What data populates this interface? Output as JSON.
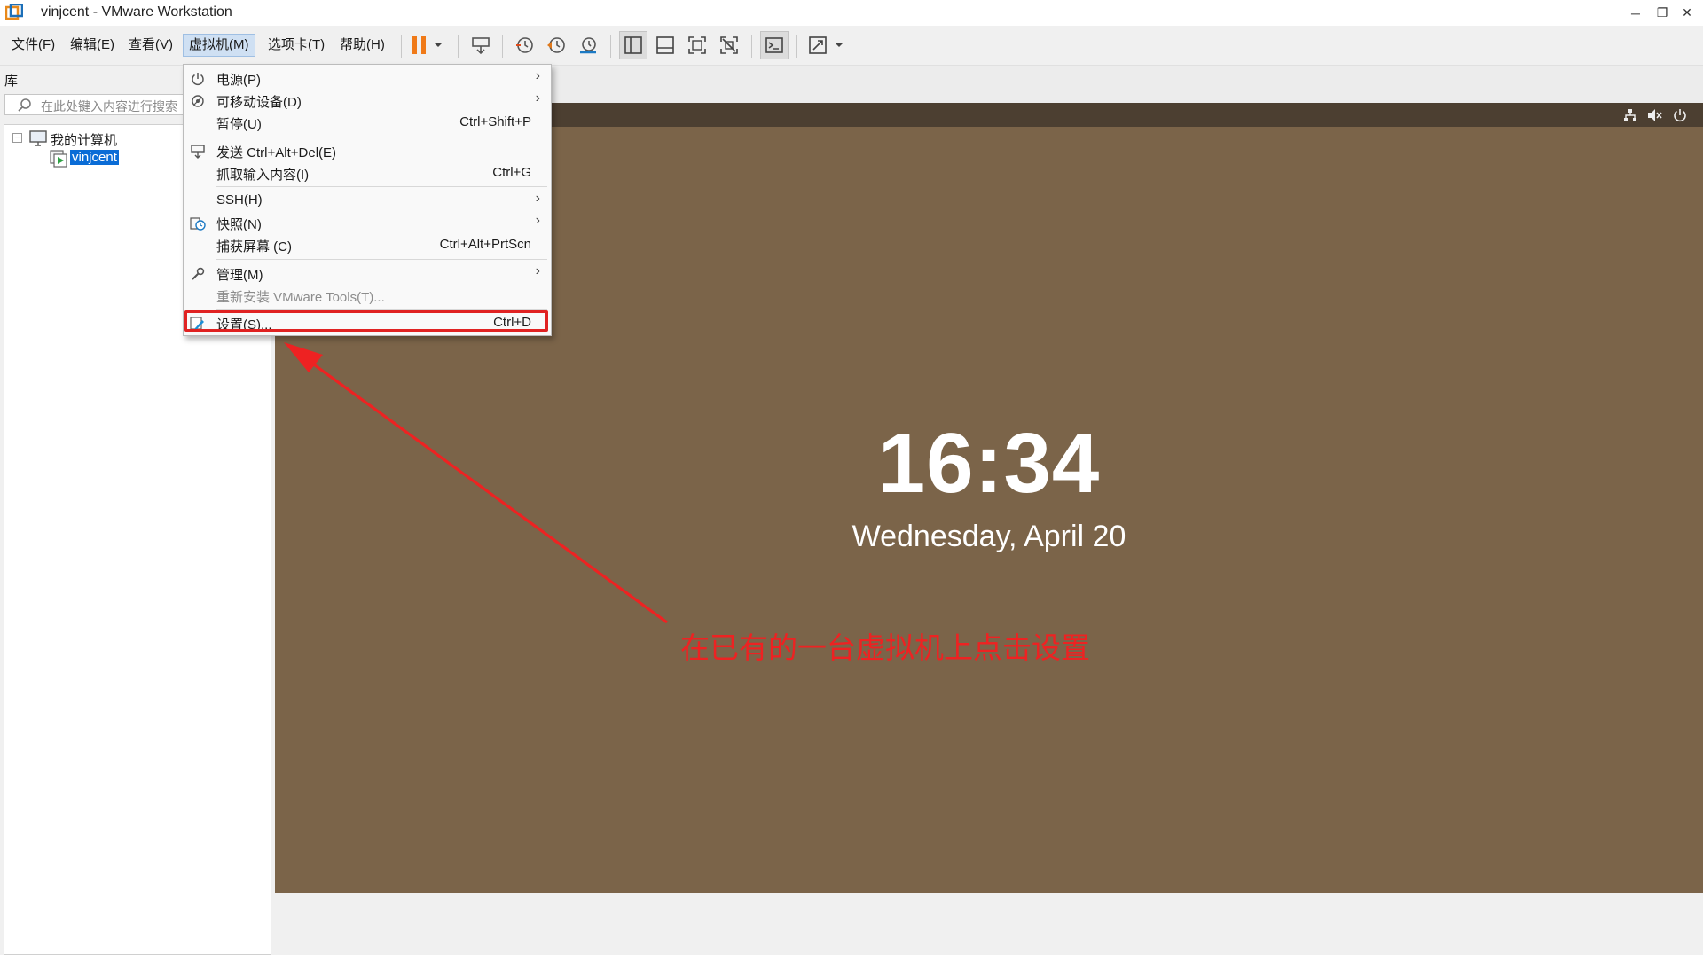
{
  "window": {
    "title": "vinjcent - VMware Workstation",
    "minimize": "─",
    "restore": "❐",
    "close": "✕"
  },
  "menubar": {
    "items": [
      {
        "label": "文件(F)"
      },
      {
        "label": "编辑(E)"
      },
      {
        "label": "查看(V)"
      },
      {
        "label": "虚拟机(M)"
      },
      {
        "label": "选项卡(T)"
      },
      {
        "label": "帮助(H)"
      }
    ]
  },
  "library": {
    "label": "库",
    "search_placeholder": "在此处键入内容进行搜索",
    "tree": {
      "root": "我的计算机",
      "vm": "vinjcent"
    }
  },
  "vm_menu": {
    "items": [
      {
        "label": "电源(P)",
        "shortcut": "",
        "submenu": true,
        "icon": "power-icon"
      },
      {
        "label": "可移动设备(D)",
        "shortcut": "",
        "submenu": true,
        "icon": "removable-device-icon"
      },
      {
        "label": "暂停(U)",
        "shortcut": "Ctrl+Shift+P",
        "submenu": false,
        "icon": ""
      },
      {
        "label": "发送 Ctrl+Alt+Del(E)",
        "shortcut": "",
        "submenu": false,
        "icon": "send-keys-icon"
      },
      {
        "label": "抓取输入内容(I)",
        "shortcut": "Ctrl+G",
        "submenu": false,
        "icon": ""
      },
      {
        "label": "SSH(H)",
        "shortcut": "",
        "submenu": true,
        "icon": ""
      },
      {
        "label": "快照(N)",
        "shortcut": "",
        "submenu": true,
        "icon": "snapshot-icon"
      },
      {
        "label": "捕获屏幕 (C)",
        "shortcut": "Ctrl+Alt+PrtScn",
        "submenu": false,
        "icon": ""
      },
      {
        "label": "管理(M)",
        "shortcut": "",
        "submenu": true,
        "icon": "wrench-icon"
      },
      {
        "label": "重新安装 VMware Tools(T)...",
        "shortcut": "",
        "submenu": false,
        "icon": "",
        "disabled": true
      },
      {
        "label": "设置(S)...",
        "shortcut": "Ctrl+D",
        "submenu": false,
        "icon": "settings-icon"
      }
    ],
    "arrow_glyph": "›"
  },
  "guest": {
    "time": "16:34",
    "date": "Wednesday, April 20"
  },
  "annotation": {
    "text": "在已有的一台虚拟机上点击设置",
    "color": "#ee2222"
  },
  "colors": {
    "accent": "#0a6cd6",
    "guest_bg": "#7b6449",
    "guest_topbar": "#4c3f31",
    "highlight": "#e02222",
    "pause_orange": "#f07a18"
  }
}
